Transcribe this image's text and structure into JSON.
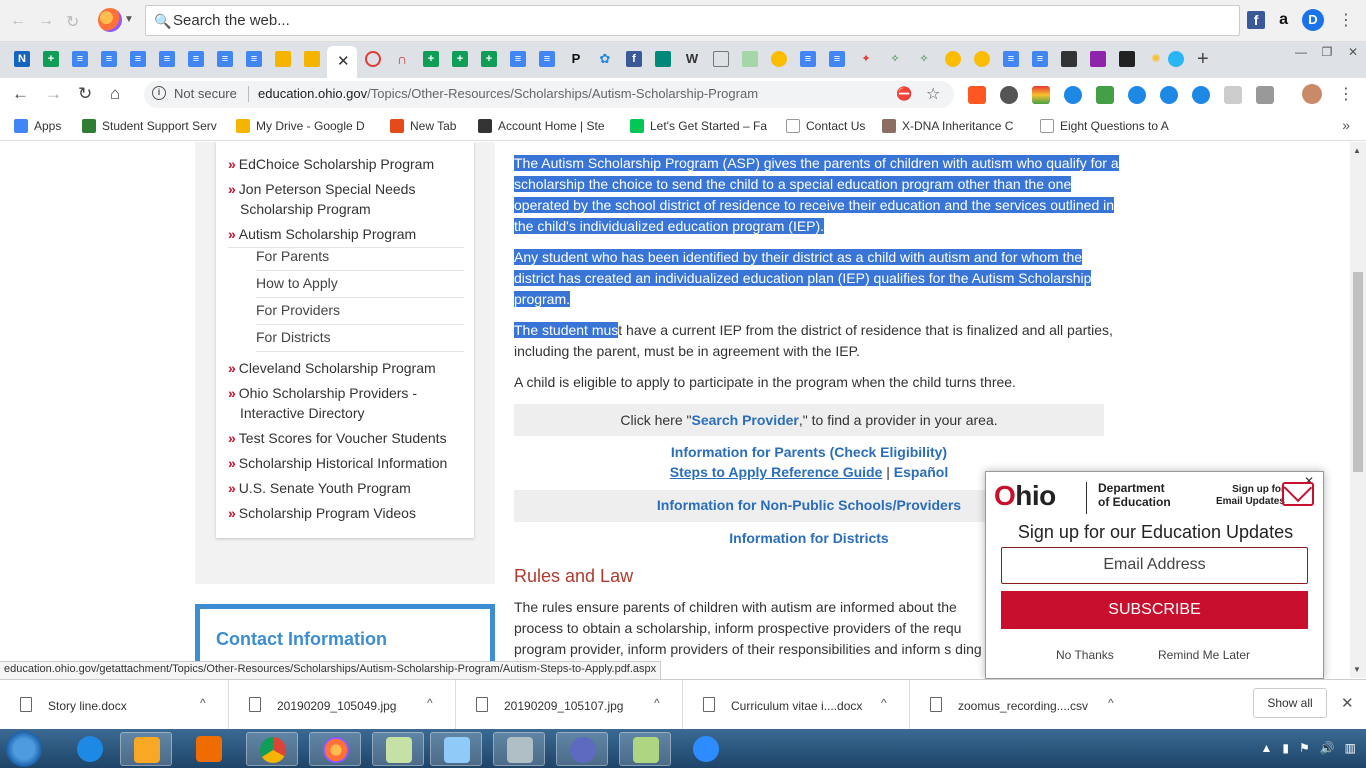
{
  "topbar": {
    "search_placeholder": "Search the web..."
  },
  "address": {
    "security": "Not secure",
    "url_domain": "education.ohio.gov",
    "url_path": "/Topics/Other-Resources/Scholarships/Autism-Scholarship-Program"
  },
  "bookmarks": [
    {
      "label": "Apps",
      "color": "#4285f4"
    },
    {
      "label": "Student Support Serv",
      "color": "#2e7d32"
    },
    {
      "label": "My Drive - Google D",
      "color": "#f4b400"
    },
    {
      "label": "New Tab",
      "color": "#e64a19"
    },
    {
      "label": "Account Home | Ste",
      "color": "#333333"
    },
    {
      "label": "Let's Get Started – Fa",
      "color": "#00c853"
    },
    {
      "label": "Contact Us",
      "color": "#999999"
    },
    {
      "label": "X-DNA Inheritance C",
      "color": "#8d6e63"
    },
    {
      "label": "Eight Questions to A",
      "color": "#999999"
    }
  ],
  "sidenav": {
    "items": [
      {
        "label": "EdChoice Scholarship Program"
      },
      {
        "label": "Jon Peterson Special Needs Scholarship Program"
      },
      {
        "label": "Autism Scholarship Program"
      },
      {
        "label": "Cleveland Scholarship Program"
      },
      {
        "label": "Ohio Scholarship Providers - Interactive Directory"
      },
      {
        "label": "Test Scores for Voucher Students"
      },
      {
        "label": "Scholarship Historical Information"
      },
      {
        "label": "U.S. Senate Youth Program"
      },
      {
        "label": "Scholarship Program Videos"
      }
    ],
    "subitems": [
      "For Parents",
      "How to Apply",
      "For Providers",
      "For Districts"
    ]
  },
  "contact": {
    "title": "Contact Information"
  },
  "content": {
    "p1": "The Autism Scholarship Program (ASP) gives the parents of children with autism who qualify for a scholarship the choice to send the child to a special education program other than the one operated by the school district of residence to receive their education and the services outlined in the child's individualized education program (IEP).",
    "p2": "Any student who has been identified by their district as a child with autism and for whom the district has created an individualized education plan (IEP) qualifies for the Autism Scholarship program.",
    "p3_selected": "The student mus",
    "p3_rest": "t have a current IEP from the district of residence that is finalized and all parties, including the parent, must be in agreement with the IEP.",
    "p4": "A child is eligible to apply to participate in the program when the child turns three.",
    "click_pre": "Click here \"",
    "click_link": "Search Provider",
    "click_post": ",\" to find a provider in your area.",
    "link_parents": "Information for Parents (Check Eligibility)",
    "link_steps": "Steps to Apply Reference Guide",
    "sep": "|",
    "link_espanol": "Español",
    "link_nonpublic": "Information for Non-Public Schools/Providers",
    "link_districts": "Information for Districts",
    "rules_heading": "Rules and Law",
    "rules_text": "The rules ensure parents of children with autism are informed about the process to obtain a scholarship, inform prospective providers of the requ program provider, inform providers of their responsibilities and inform s ding in the district who participate in the"
  },
  "statusbar": {
    "text": "education.ohio.gov/getattachment/Topics/Other-Resources/Scholarships/Autism-Scholarship-Program/Autism-Steps-to-Apply.pdf.aspx"
  },
  "popup": {
    "logo_o": "O",
    "logo_rest": "hio",
    "dept_line1": "Department",
    "dept_line2": "of Education",
    "signup_mini_1": "Sign up for",
    "signup_mini_2": "Email Updates",
    "heading": "Sign up for our Education Updates",
    "email_placeholder": "Email Address",
    "subscribe": "SUBSCRIBE",
    "no_thanks": "No Thanks",
    "remind": "Remind Me Later"
  },
  "downloads": {
    "items": [
      {
        "name": "Story line.docx"
      },
      {
        "name": "20190209_105049.jpg"
      },
      {
        "name": "20190209_105107.jpg"
      },
      {
        "name": "Curriculum vitae i....docx"
      },
      {
        "name": "zoomus_recording....csv"
      }
    ],
    "show_all": "Show all"
  }
}
